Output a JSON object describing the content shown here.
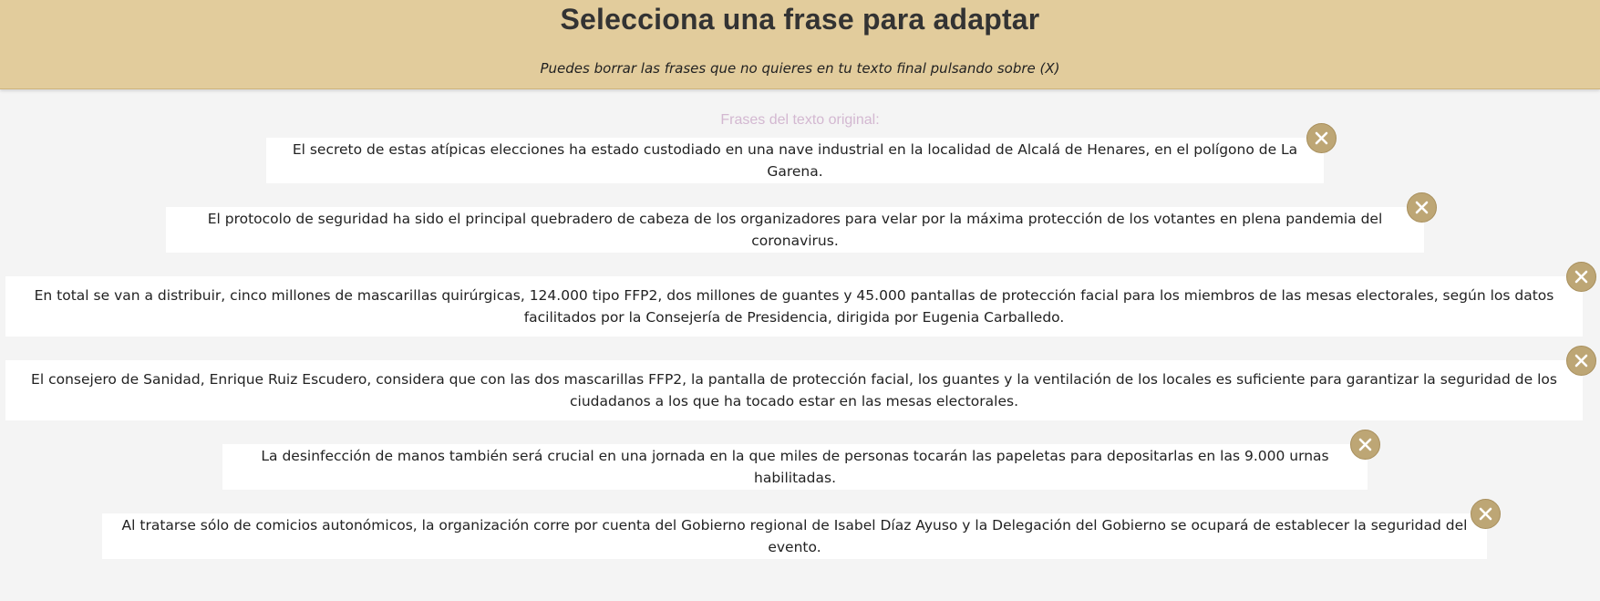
{
  "header": {
    "title": "Selecciona una frase para adaptar",
    "subtitle": "Puedes borrar las frases que no quieres en tu texto final pulsando sobre (X)"
  },
  "section_label": "Frases del texto original:",
  "sentences": [
    {
      "text": "El secreto de estas atípicas elecciones ha estado custodiado en una nave industrial en la localidad de Alcalá de Henares, en el polígono de La Garena.",
      "remove_icon": "close-icon"
    },
    {
      "text": "El protocolo de seguridad ha sido el principal quebradero de cabeza de los organizadores para velar por la máxima protección de los votantes en plena pandemia del coronavirus.",
      "remove_icon": "close-icon"
    },
    {
      "text": "En total se van a distribuir, cinco millones de mascarillas quirúrgicas, 124.000 tipo FFP2, dos millones de guantes y 45.000 pantallas de protección facial para los miembros de las mesas electorales, según los datos facilitados por la Consejería de Presidencia, dirigida por Eugenia Carballedo.",
      "remove_icon": "close-icon"
    },
    {
      "text": "El consejero de Sanidad, Enrique Ruiz Escudero, considera que con las dos mascarillas FFP2, la pantalla de protección facial, los guantes y la ventilación de los locales es suficiente para garantizar la seguridad de los ciudadanos a los que ha tocado estar en las mesas electorales.",
      "remove_icon": "close-icon"
    },
    {
      "text": "La desinfección de manos también será crucial en una jornada en la que miles de personas tocarán las papeletas para depositarlas en las 9.000 urnas habilitadas.",
      "remove_icon": "close-icon"
    },
    {
      "text": "Al tratarse sólo de comicios autonómicos, la organización corre por cuenta del Gobierno regional de Isabel Díaz Ayuso y la Delegación del Gobierno se ocupará de establecer la seguridad del evento.",
      "remove_icon": "close-icon"
    }
  ],
  "colors": {
    "header_bg": "#e2cc9c",
    "page_bg": "#f4f4f4",
    "remove_button": "#bda675",
    "section_label": "#d3b8d1"
  }
}
